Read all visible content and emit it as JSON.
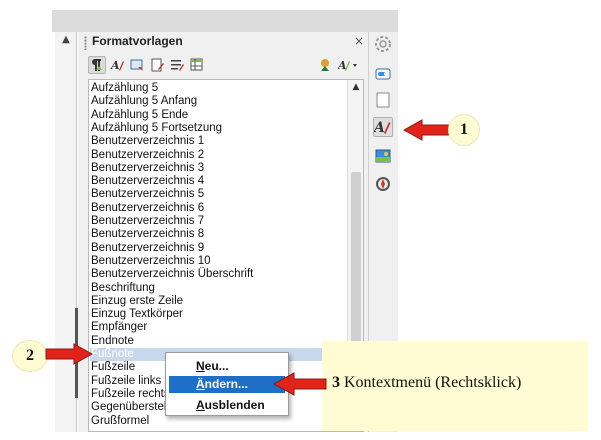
{
  "panel": {
    "title": "Formatvorlagen",
    "close_glyph": "×"
  },
  "styles_list": [
    "Aufzählung 5",
    "Aufzählung 5 Anfang",
    "Aufzählung 5 Ende",
    "Aufzählung 5 Fortsetzung",
    "Benutzerverzeichnis 1",
    "Benutzerverzeichnis 2",
    "Benutzerverzeichnis 3",
    "Benutzerverzeichnis 4",
    "Benutzerverzeichnis 5",
    "Benutzerverzeichnis 6",
    "Benutzerverzeichnis 7",
    "Benutzerverzeichnis 8",
    "Benutzerverzeichnis 9",
    "Benutzerverzeichnis 10",
    "Benutzerverzeichnis Überschrift",
    "Beschriftung",
    "Einzug erste Zeile",
    "Einzug Textkörper",
    "Empfänger",
    "Endnote",
    "Fußnote",
    "Fußzeile",
    "Fußzeile links",
    "Fußzeile rechts",
    "Gegenüberstellung",
    "Grußformel"
  ],
  "selected_style": "Fußnote",
  "context_menu": {
    "items": [
      {
        "label": "Neu...",
        "underline": "N",
        "rest": "eu..."
      },
      {
        "label": "Ändern...",
        "underline": "Ä",
        "rest": "ndern..."
      },
      {
        "label": "Ausblenden",
        "underline": "A",
        "rest": "usblenden"
      }
    ],
    "highlighted": "Ändern..."
  },
  "callouts": {
    "one": "1",
    "two": "2",
    "three_number": "3",
    "three_text": "Kontextmenü (Rechtsklick)"
  },
  "icons": {
    "toolbar": [
      "paragraph-styles-icon",
      "character-styles-icon",
      "frame-styles-icon",
      "page-styles-icon",
      "list-styles-icon",
      "table-styles-icon",
      "fill-format-mode-icon",
      "new-style-from-selection-icon"
    ],
    "sidebar": [
      "properties-icon",
      "page-icon",
      "styles-icon",
      "gallery-icon",
      "navigator-icon"
    ]
  },
  "colors": {
    "selection": "#c8d8ec",
    "menu_highlight": "#1e6fc8",
    "callout_fill": "#fffbd2",
    "arrow_red": "#e2231a"
  }
}
